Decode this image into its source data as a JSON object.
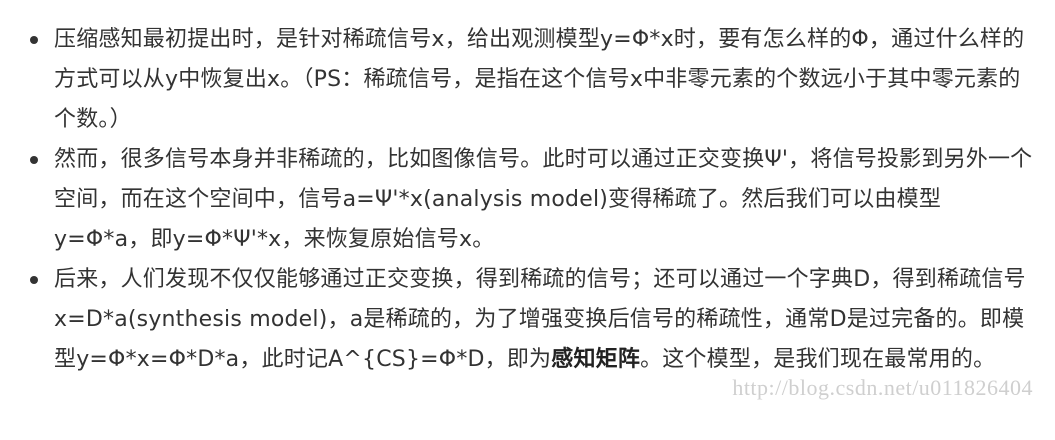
{
  "bullets": [
    {
      "text": "压缩感知最初提出时，是针对稀疏信号x，给出观测模型y=Φ*x时，要有怎么样的Φ，通过什么样的方式可以从y中恢复出x。（PS：稀疏信号，是指在这个信号x中非零元素的个数远小于其中零元素的个数。）"
    },
    {
      "text": "然而，很多信号本身并非稀疏的，比如图像信号。此时可以通过正交变换Ψ'，将信号投影到另外一个空间，而在这个空间中，信号a=Ψ'*x(analysis model)变得稀疏了。然后我们可以由模型y=Φ*a，即y=Φ*Ψ'*x，来恢复原始信号x。"
    },
    {
      "text_before": "后来，人们发现不仅仅能够通过正交变换，得到稀疏的信号；还可以通过一个字典D，得到稀疏信号x=D*a(synthesis model)，a是稀疏的，为了增强变换后信号的稀疏性，通常D是过完备的。即模型y=Φ*x=Φ*D*a，此时记A^{CS}=Φ*D，即为",
      "bold_text": "感知矩阵",
      "text_after": "。这个模型，是我们现在最常用的。"
    }
  ],
  "watermark": "http://blog.csdn.net/u011826404"
}
